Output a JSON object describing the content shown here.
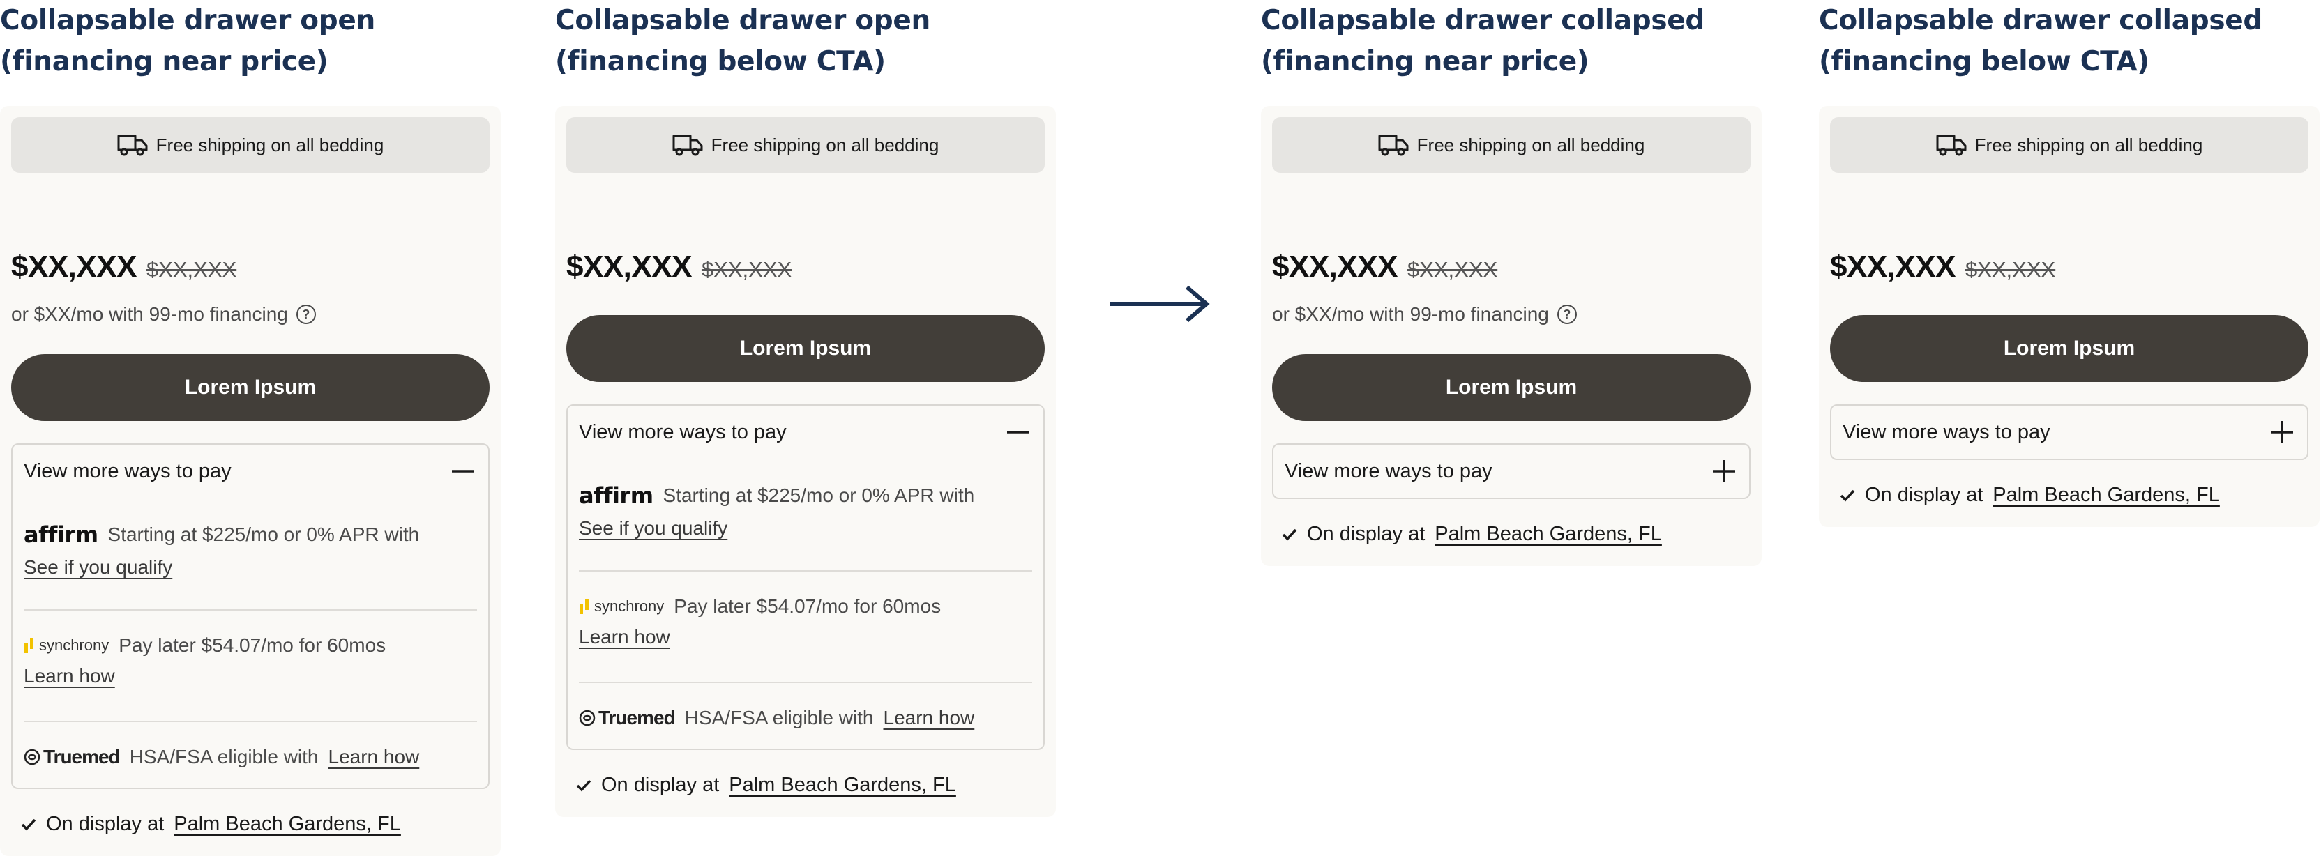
{
  "columns": [
    {
      "title_line1": "Collapsable drawer open",
      "title_line2": "(financing near price)",
      "state": "open",
      "financing_position": "near-price"
    },
    {
      "title_line1": "Collapsable drawer open",
      "title_line2": "(financing below CTA)",
      "state": "open",
      "financing_position": "below-cta"
    },
    {
      "title_line1": "Collapsable drawer collapsed",
      "title_line2": "(financing near price)",
      "state": "collapsed",
      "financing_position": "near-price"
    },
    {
      "title_line1": "Collapsable drawer collapsed",
      "title_line2": "(financing below CTA)",
      "state": "collapsed",
      "financing_position": "below-cta"
    }
  ],
  "card": {
    "shipping_text": "Free shipping on all bedding",
    "shipping_icon": "truck-icon",
    "price": "$XX,XXX",
    "old_price": "$XX,XXX",
    "financing_text": "or $XX/mo with 99-mo financing",
    "financing_icon": "question-circle-icon",
    "cta_label": "Lorem Ipsum",
    "drawer_label": "View more ways to pay",
    "drawer_open_icon": "minus-icon",
    "drawer_closed_icon": "plus-icon",
    "affirm": {
      "logo": "affirm",
      "text": "Starting at $225/mo or 0% APR with",
      "link": "See if you qualify"
    },
    "synchrony": {
      "logo": "synchrony",
      "text": "Pay later $54.07/mo for 60mos",
      "link": "Learn how"
    },
    "truemed": {
      "logo": "Truemed",
      "text": "HSA/FSA eligible with",
      "link": "Learn how"
    },
    "display_prefix": "On display at",
    "display_location": "Palm Beach Gardens, FL",
    "display_icon": "checkmark-icon"
  },
  "colors": {
    "title": "#1b3153",
    "cta_bg": "#423e39",
    "card_bg": "#faf9f6",
    "shipping_bg": "#e6e5e2",
    "synchrony_gold": "#f2c200"
  },
  "arrow_icon": "arrow-right-icon"
}
